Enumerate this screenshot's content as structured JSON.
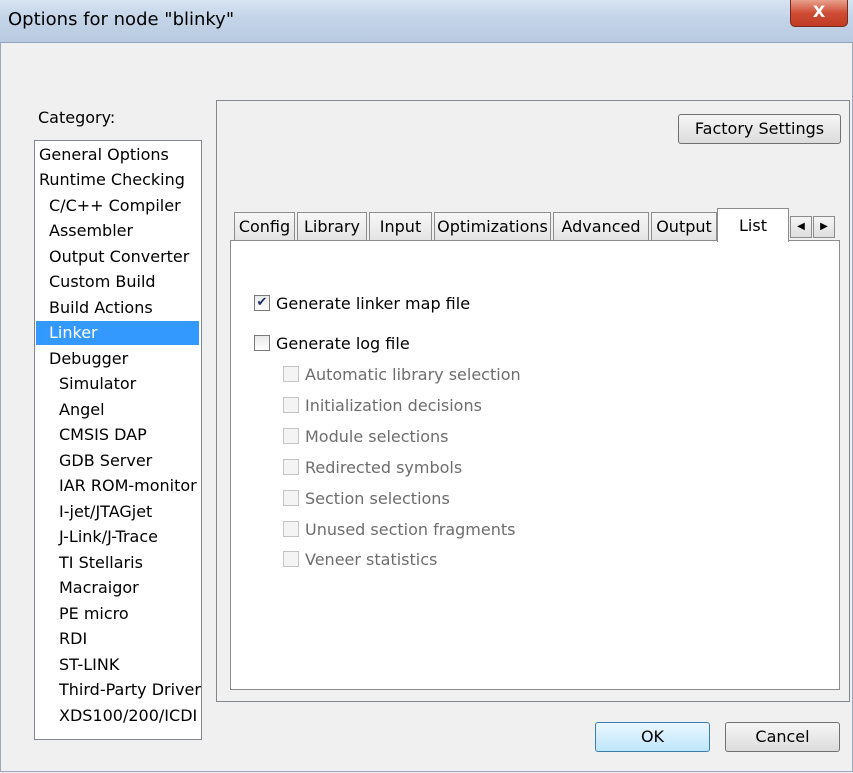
{
  "window": {
    "title": "Options for node \"blinky\"",
    "close_glyph": "X"
  },
  "category": {
    "label": "Category:",
    "items": [
      {
        "label": "General Options"
      },
      {
        "label": "Runtime Checking"
      },
      {
        "label": "C/C++ Compiler"
      },
      {
        "label": "Assembler"
      },
      {
        "label": "Output Converter"
      },
      {
        "label": "Custom Build"
      },
      {
        "label": "Build Actions"
      },
      {
        "label": "Linker"
      },
      {
        "label": "Debugger"
      },
      {
        "label": "Simulator"
      },
      {
        "label": "Angel"
      },
      {
        "label": "CMSIS DAP"
      },
      {
        "label": "GDB Server"
      },
      {
        "label": "IAR ROM-monitor"
      },
      {
        "label": "I-jet/JTAGjet"
      },
      {
        "label": "J-Link/J-Trace"
      },
      {
        "label": "TI Stellaris"
      },
      {
        "label": "Macraigor"
      },
      {
        "label": "PE micro"
      },
      {
        "label": "RDI"
      },
      {
        "label": "ST-LINK"
      },
      {
        "label": "Third-Party Driver"
      },
      {
        "label": "XDS100/200/ICDI"
      }
    ],
    "selected": "Linker"
  },
  "factory_settings_label": "Factory Settings",
  "tabs": [
    {
      "label": "Config"
    },
    {
      "label": "Library"
    },
    {
      "label": "Input"
    },
    {
      "label": "Optimizations"
    },
    {
      "label": "Advanced"
    },
    {
      "label": "Output"
    },
    {
      "label": "List"
    }
  ],
  "active_tab": "List",
  "tab_scroll": {
    "left_glyph": "◀",
    "right_glyph": "▶"
  },
  "options": {
    "generate_map": {
      "label": "Generate linker map file",
      "checked": true,
      "check_glyph": "✔"
    },
    "generate_log": {
      "label": "Generate log file",
      "checked": false
    },
    "log_suboptions": [
      {
        "label": "Automatic library selection"
      },
      {
        "label": "Initialization decisions"
      },
      {
        "label": "Module selections"
      },
      {
        "label": "Redirected symbols"
      },
      {
        "label": "Section selections"
      },
      {
        "label": "Unused section fragments"
      },
      {
        "label": "Veneer statistics"
      }
    ]
  },
  "buttons": {
    "ok": "OK",
    "cancel": "Cancel"
  },
  "colors": {
    "selection": "#3399ff",
    "titlebar": "#c3d4e8",
    "close": "#cf4c34"
  }
}
